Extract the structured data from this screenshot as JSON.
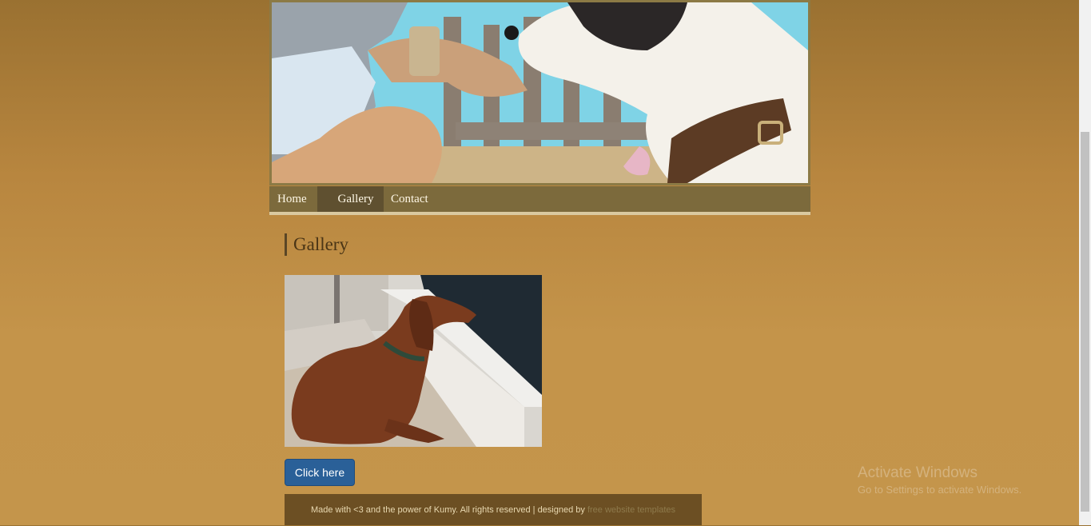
{
  "nav": {
    "items": [
      {
        "label": "Home"
      },
      {
        "label": "Gallery"
      },
      {
        "label": "Contact"
      }
    ],
    "active": "Gallery"
  },
  "main": {
    "heading": "Gallery",
    "button_label": "Click here"
  },
  "footer": {
    "text": "Made with <3 and the power of Kumy. All rights reserved | designed by ",
    "link_text": "free website templates"
  },
  "windows_watermark": {
    "title": "Activate Windows",
    "subtitle": "Go to Settings to activate Windows."
  },
  "colors": {
    "accent_button": "#2a6098",
    "nav_bar": "#7c6a3c",
    "nav_active": "#5f5030",
    "footer_bg": "#6c4f23"
  }
}
